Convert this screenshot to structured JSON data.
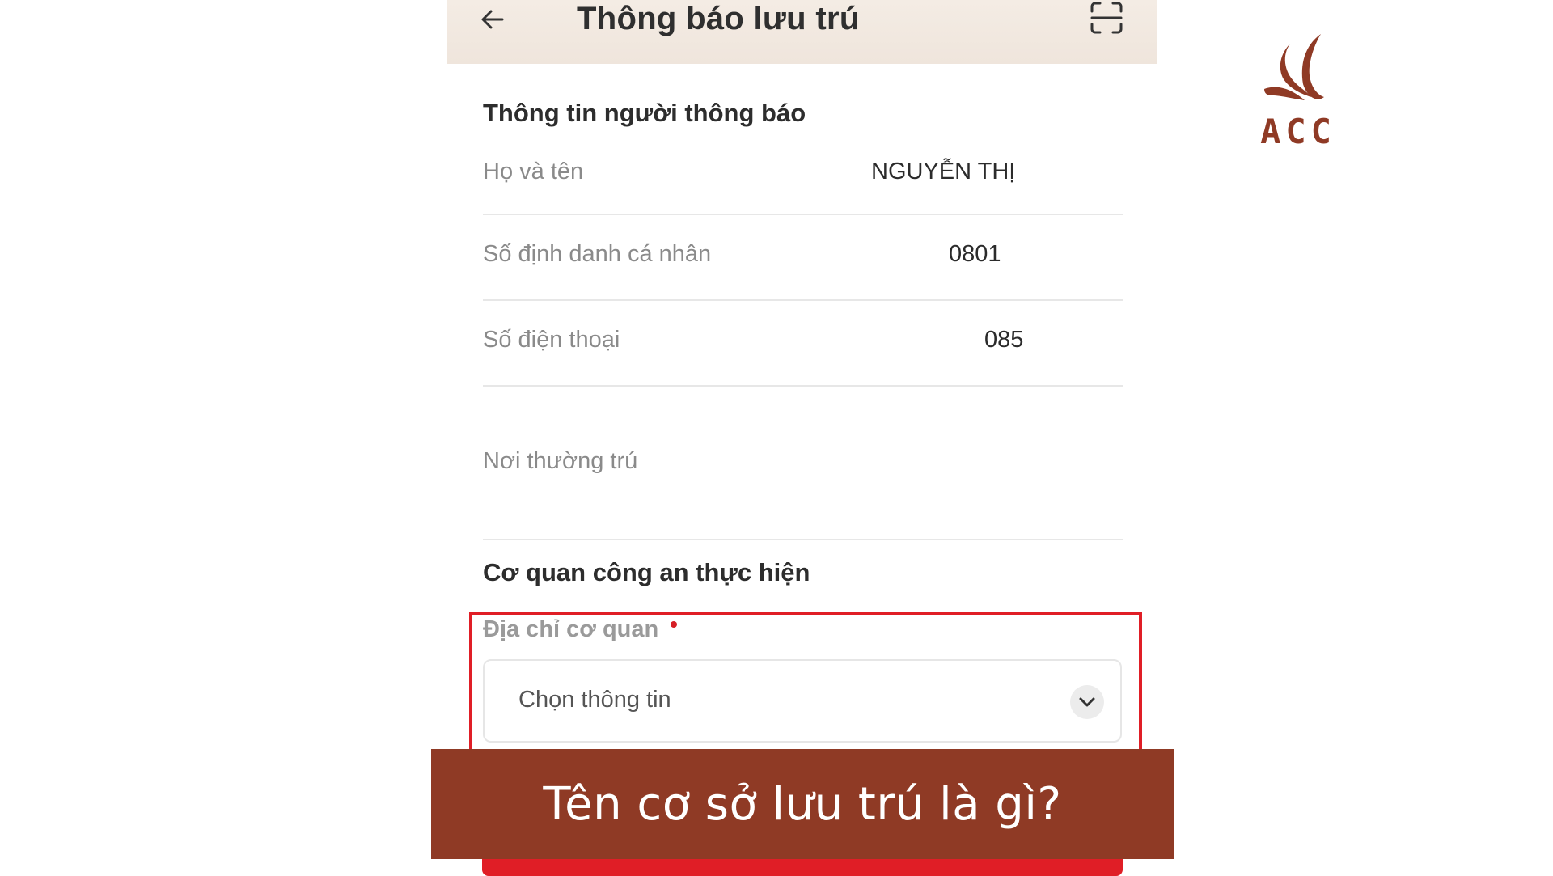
{
  "header": {
    "title": "Thông báo lưu trú",
    "back_icon": "arrow-left-icon",
    "scan_icon": "scan-frame-icon"
  },
  "notifier_section": {
    "title": "Thông tin người thông báo",
    "rows": [
      {
        "label": "Họ và tên",
        "value": "NGUYỄN THỊ"
      },
      {
        "label": "Số định danh cá nhân",
        "value": "0801"
      },
      {
        "label": "Số điện thoại",
        "value": "085"
      },
      {
        "label": "Nơi thường trú",
        "value": ""
      }
    ]
  },
  "police_section": {
    "title": "Cơ quan công an thực hiện",
    "field_label": "Địa chỉ cơ quan",
    "select_placeholder": "Chọn thông tin",
    "chevron_icon": "chevron-down-icon"
  },
  "banner": {
    "text": "Tên cơ sở lưu trú là gì?"
  },
  "logo": {
    "text": "ACC",
    "icon": "flame-leaf-icon"
  },
  "colors": {
    "brand": "#8f3a25",
    "highlight": "#e01e26",
    "header_bg": "#f1e8df"
  }
}
